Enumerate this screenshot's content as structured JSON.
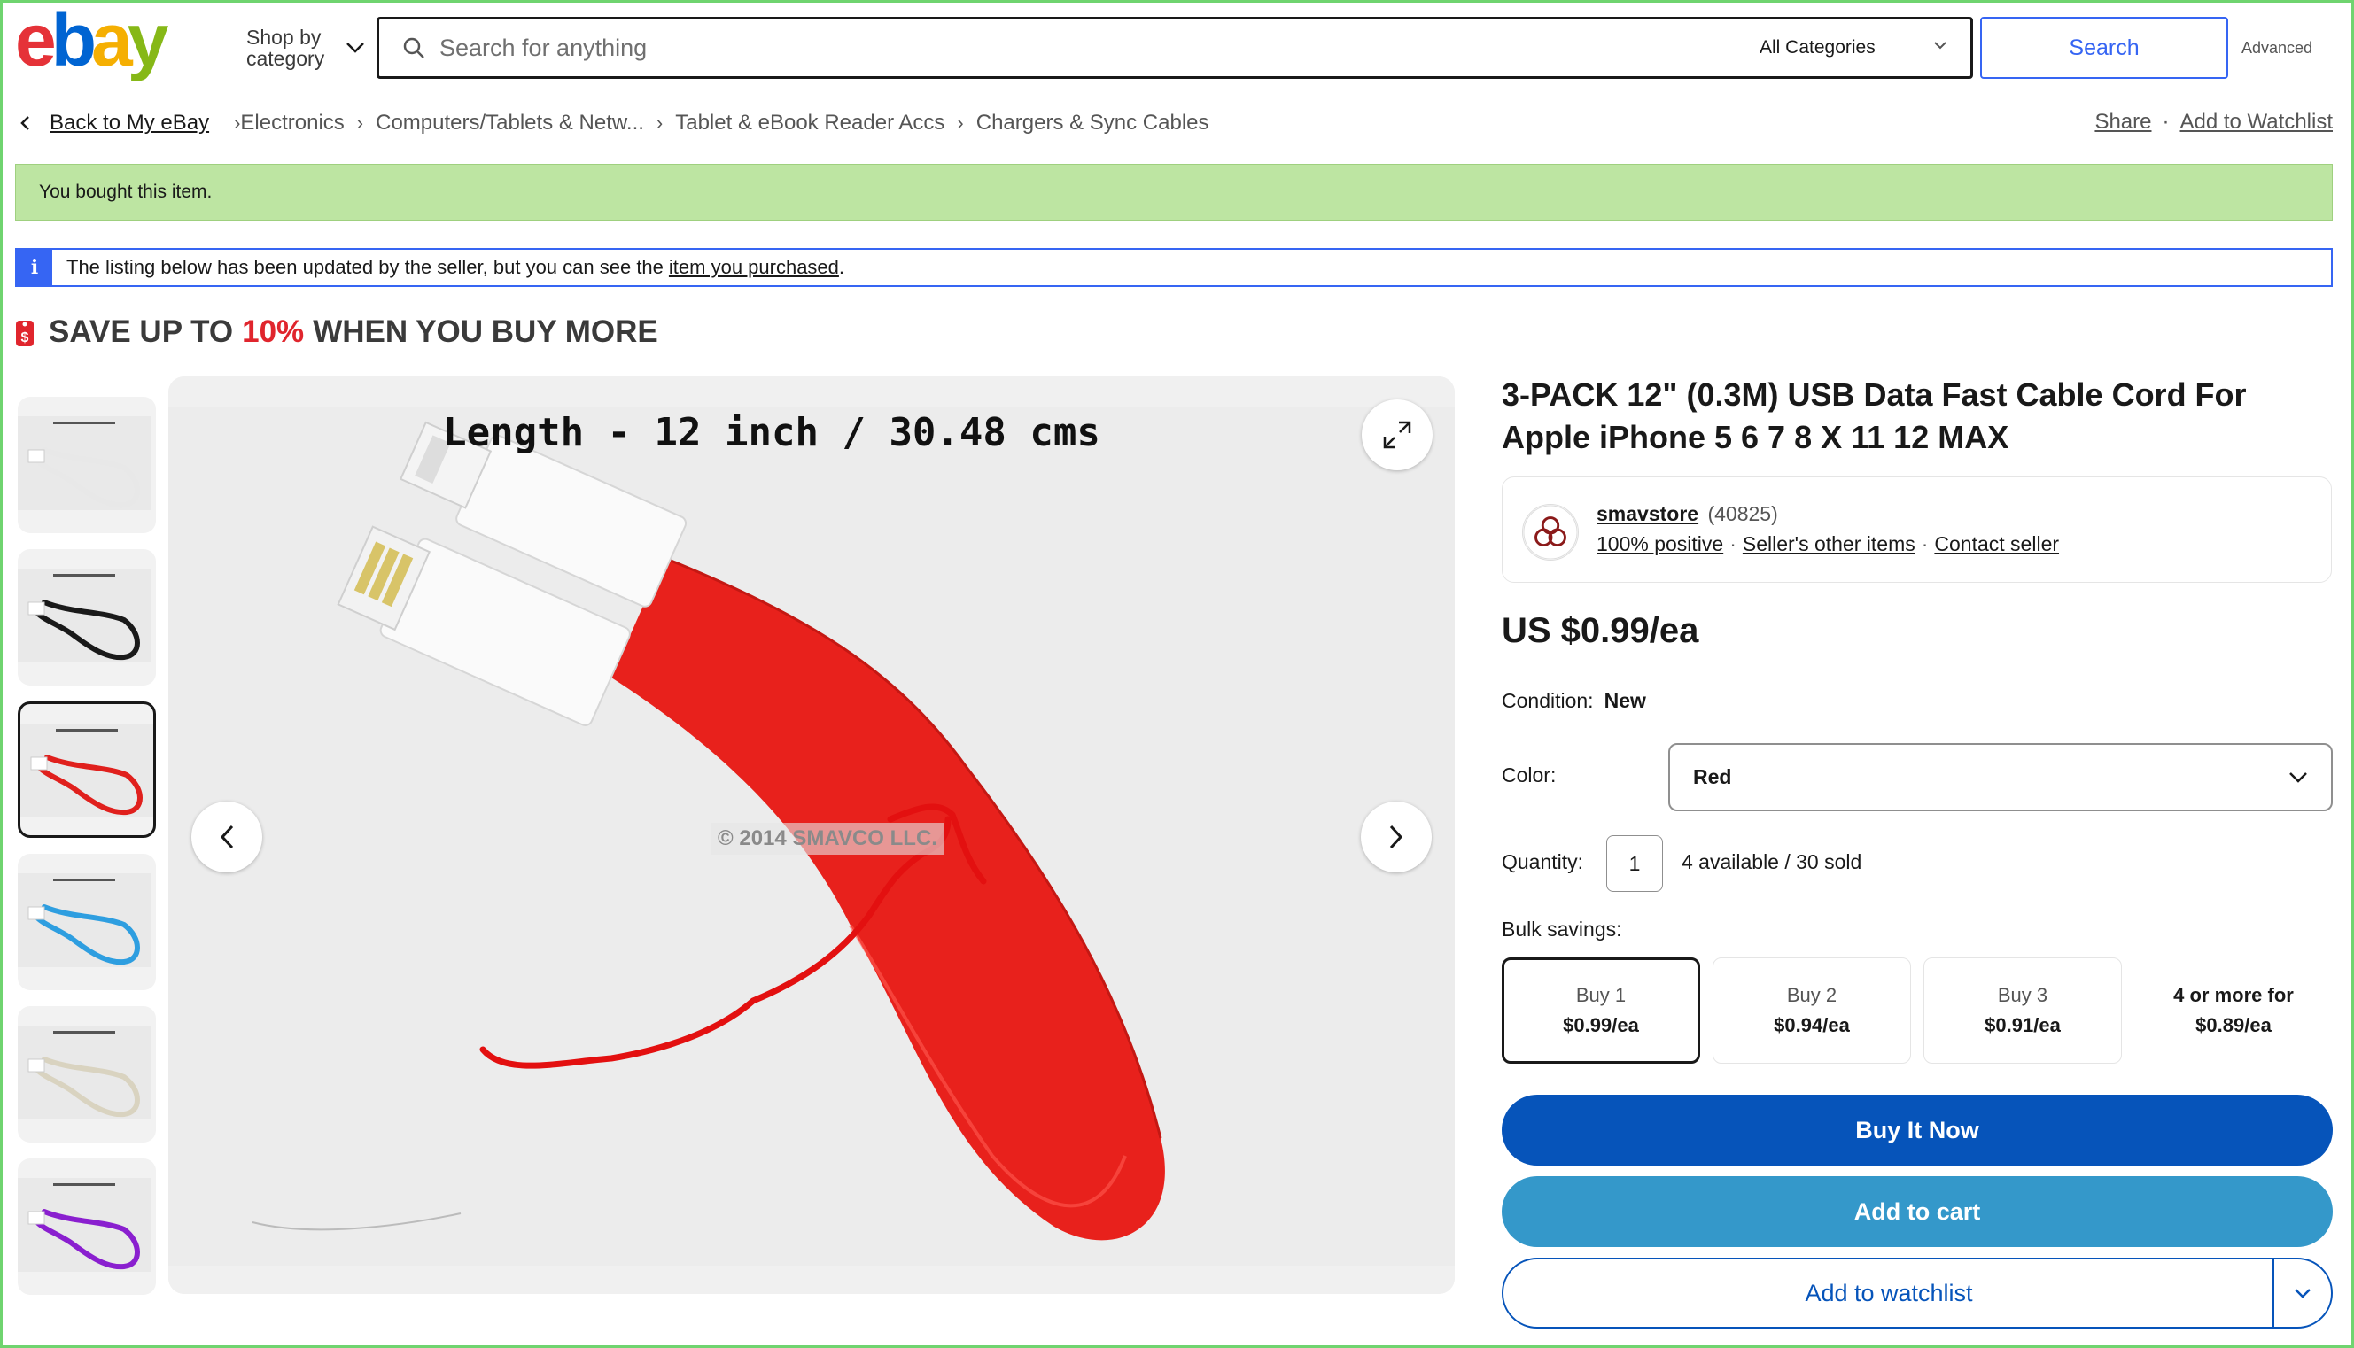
{
  "header": {
    "logo_text": "ebay",
    "shop_by_category": "Shop by category",
    "search_placeholder": "Search for anything",
    "category_select": "All Categories",
    "search_button": "Search",
    "advanced": "Advanced"
  },
  "breadcrumb": {
    "back": "Back to My eBay",
    "items": [
      "Electronics",
      "Computers/Tablets & Netw...",
      "Tablet & eBook Reader Accs",
      "Chargers & Sync Cables"
    ]
  },
  "actions": {
    "share": "Share",
    "watchlist": "Add to Watchlist",
    "separator": "·"
  },
  "banners": {
    "bought": "You bought this item.",
    "info_prefix": "The listing below has been updated by the seller, but you can see the",
    "info_link": "item you purchased",
    "info_suffix": ".",
    "info_icon": "i"
  },
  "promo": {
    "prefix": "SAVE UP TO",
    "percent": "10%",
    "suffix": "WHEN YOU BUY MORE"
  },
  "gallery": {
    "thumb_colors": [
      "#e8e8e8",
      "#1a1a1a",
      "#e0201d",
      "#2e9ee0",
      "#d9d3c0",
      "#8a1fcf"
    ],
    "selected_index": 2,
    "image_title": "Length - 12 inch / 30.48 cms",
    "watermark": "© 2014 SMAVCO LLC."
  },
  "product": {
    "title": "3-PACK 12\" (0.3M) USB Data Fast Cable Cord For Apple iPhone 5 6 7 8 X 11 12 MAX",
    "seller": {
      "name": "smavstore",
      "feedback": "(40825)",
      "positive": "100% positive",
      "other_items": "Seller's other items",
      "contact": "Contact seller"
    },
    "price": "US $0.99/ea",
    "condition_label": "Condition:",
    "condition_value": "New",
    "color_label": "Color:",
    "color_value": "Red",
    "quantity_label": "Quantity:",
    "quantity_value": "1",
    "availability": "4 available / 30 sold",
    "bulk_label": "Bulk savings:",
    "tiers": [
      {
        "label": "Buy 1",
        "price": "$0.99/ea"
      },
      {
        "label": "Buy 2",
        "price": "$0.94/ea"
      },
      {
        "label": "Buy 3",
        "price": "$0.91/ea"
      },
      {
        "label": "4 or more for",
        "price": "$0.89/ea"
      }
    ],
    "buy_now": "Buy It Now",
    "add_to_cart": "Add to cart",
    "add_to_watchlist": "Add to watchlist"
  },
  "colors": {
    "accent_blue": "#3665f3",
    "buy_now": "#0654ba",
    "add_cart": "#3498ca",
    "bought_bg": "#bde5a2",
    "promo_red": "#e0252d",
    "cable_red": "#e8211c"
  }
}
